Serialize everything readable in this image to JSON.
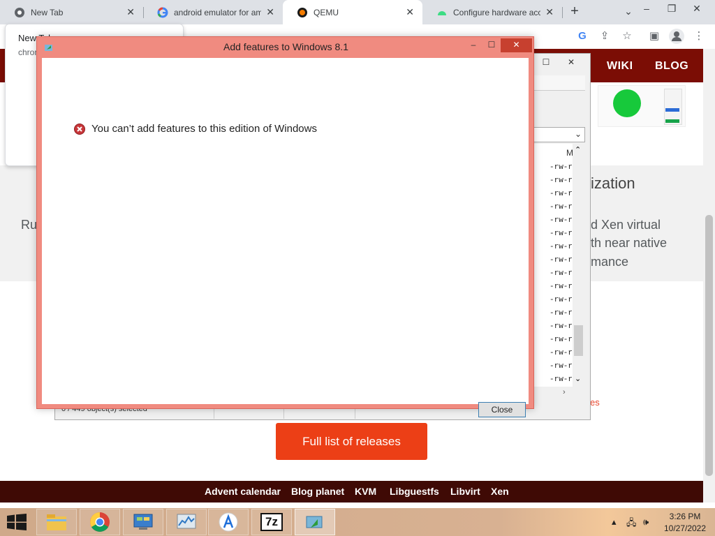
{
  "browser": {
    "tabs": [
      {
        "title": "New Tab",
        "icon": "chrome-icon"
      },
      {
        "title": "android emulator for am",
        "icon": "google-icon"
      },
      {
        "title": "QEMU",
        "icon": "qemu-icon"
      },
      {
        "title": "Configure hardware acce",
        "icon": "android-icon"
      }
    ],
    "new_tab_symbol": "+",
    "tab_close_symbol": "✕",
    "popup": {
      "line1": "New Tab",
      "line2": "chrom"
    }
  },
  "site": {
    "nav": [
      "WIKI",
      "BLOG"
    ],
    "heading_fragment": "ization",
    "left_fragment": "Ru",
    "paragraph_lines": [
      "d Xen virtual",
      "th near native",
      "mance"
    ],
    "releases_link_fragment": "es",
    "releases_button": "Full list of releases",
    "footer_links": [
      "Advent calendar",
      "Blog planet",
      "KVM",
      "Libguestfs",
      "Libvirt",
      "Xen"
    ]
  },
  "file_manager": {
    "column_header_fragment": "M",
    "permission_rows": [
      "-rw-rv",
      "-rw-rv",
      "-rw-rv",
      "-rw-rv",
      "-rw-rv",
      "-rw-rv",
      "-rw-rv",
      "-rw-rv",
      "-rw-rv",
      "-rw-rv",
      "-rw-rv",
      "-rw-rv",
      "-rw-rv",
      "-rw-rv",
      "-rw-rv",
      "-rw-rv",
      "-rw-rv"
    ],
    "status_text": "0 / 449 object(s) selected"
  },
  "dialog": {
    "title": "Add features to Windows 8.1",
    "message": "You can’t add features to this edition of Windows",
    "close_button": "Close",
    "accent": "#f08b80"
  },
  "taskbar": {
    "apps": [
      "file-explorer-icon",
      "chrome-icon",
      "control-panel-icon",
      "performance-monitor-icon",
      "android-studio-icon",
      "7zip-icon",
      "add-features-icon"
    ],
    "seven_zip_label": "7z",
    "time": "3:26 PM",
    "date": "10/27/2022"
  }
}
